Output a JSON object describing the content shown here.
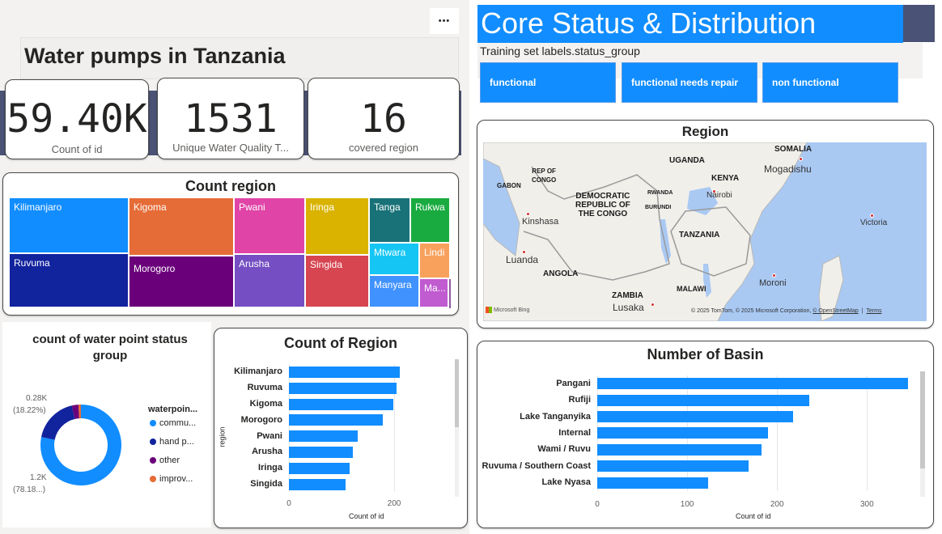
{
  "header": {
    "title": "Water pumps in Tanzania",
    "more_icon": "more-options-icon",
    "more_glyph": "•••"
  },
  "kpis": [
    {
      "value": "59.40K",
      "label": "Count of id"
    },
    {
      "value": "1531",
      "label": "Unique Water Quality T..."
    },
    {
      "value": "16",
      "label": "covered region"
    }
  ],
  "treemap": {
    "title": "Count region",
    "tiles": [
      {
        "label": "Kilimanjaro",
        "color": "#118dff"
      },
      {
        "label": "Ruvuma",
        "color": "#12239e"
      },
      {
        "label": "Kigoma",
        "color": "#e66c37"
      },
      {
        "label": "Morogoro",
        "color": "#6b007b"
      },
      {
        "label": "Pwani",
        "color": "#e044a7"
      },
      {
        "label": "Arusha",
        "color": "#744ec2"
      },
      {
        "label": "Iringa",
        "color": "#d9b300"
      },
      {
        "label": "Singida",
        "color": "#d64550"
      },
      {
        "label": "Tanga",
        "color": "#197278"
      },
      {
        "label": "Rukwa",
        "color": "#1aab40"
      },
      {
        "label": "Mtwara",
        "color": "#15c6f4"
      },
      {
        "label": "Lindi",
        "color": "#f8a15d"
      },
      {
        "label": "Manyara",
        "color": "#4092ff"
      },
      {
        "label": "Ma...",
        "color": "#c05bd0"
      }
    ]
  },
  "donut": {
    "title_line1": "count of water point status",
    "title_line2": "group",
    "legend_title": "waterpoin...",
    "legend": [
      {
        "label": "commu...",
        "color": "#118dff"
      },
      {
        "label": "hand p...",
        "color": "#12239e"
      },
      {
        "label": "other",
        "color": "#6b007b"
      },
      {
        "label": "improv...",
        "color": "#e66c37"
      }
    ],
    "label_top_value": "0.28K",
    "label_top_pct": "(18.22%)",
    "label_bottom_value": "1.2K",
    "label_bottom_pct": "(78.18...)"
  },
  "right_header": {
    "title": "Core Status & Distribution",
    "filter_label": "Training set labels.status_group",
    "slicers": [
      "functional",
      "functional needs repair",
      "non functional"
    ],
    "accent": "#118dff"
  },
  "map": {
    "title": "Region",
    "countries": [
      "SOMALIA",
      "UGANDA",
      "KENYA",
      "GABON",
      "REP OF\nCONGO",
      "DEMOCRATIC\nREPUBLIC OF\nTHE CONGO",
      "RWANDA",
      "BURUNDI",
      "TANZANIA",
      "ANGOLA",
      "ZAMBIA",
      "MALAWI"
    ],
    "cities": [
      "Mogadishu",
      "Nairobi",
      "Kinshasa",
      "Victoria",
      "Luanda",
      "Moroni",
      "Lusaka"
    ],
    "bing_label": "Microsoft Bing",
    "copyright": "© 2025 TomTom, © 2025 Microsoft Corporation, ",
    "osm_link": "© OpenStreetMap",
    "terms_link": "Terms"
  },
  "chart_data": [
    {
      "type": "bar",
      "title": "Count of Region",
      "xlabel": "Count of id",
      "ylabel": "region",
      "categories": [
        "Kilimanjaro",
        "Ruvuma",
        "Kigoma",
        "Morogoro",
        "Pwani",
        "Arusha",
        "Iringa",
        "Singida"
      ],
      "values": [
        210,
        205,
        198,
        178,
        130,
        122,
        116,
        108
      ],
      "xlim": [
        0,
        300
      ],
      "xticks": [
        "0",
        "200"
      ],
      "xtick_values": [
        0,
        200
      ]
    },
    {
      "type": "bar",
      "title": "Number of Basin",
      "xlabel": "Count of id",
      "ylabel": "",
      "categories": [
        "Pangani",
        "Rufiji",
        "Lake Tanganyika",
        "Internal",
        "Wami / Ruvu",
        "Ruvuma / Southern Coast",
        "Lake Nyasa"
      ],
      "values": [
        346,
        236,
        218,
        190,
        183,
        168,
        123
      ],
      "xlim": [
        0,
        360
      ],
      "xticks": [
        "0",
        "100",
        "200",
        "300"
      ],
      "xtick_values": [
        0,
        100,
        200,
        300
      ]
    },
    {
      "type": "pie",
      "title": "count of water point status group",
      "categories": [
        "commu...",
        "hand p...",
        "other",
        "improv..."
      ],
      "values": [
        78.18,
        18.22,
        2.6,
        1.0
      ]
    }
  ]
}
